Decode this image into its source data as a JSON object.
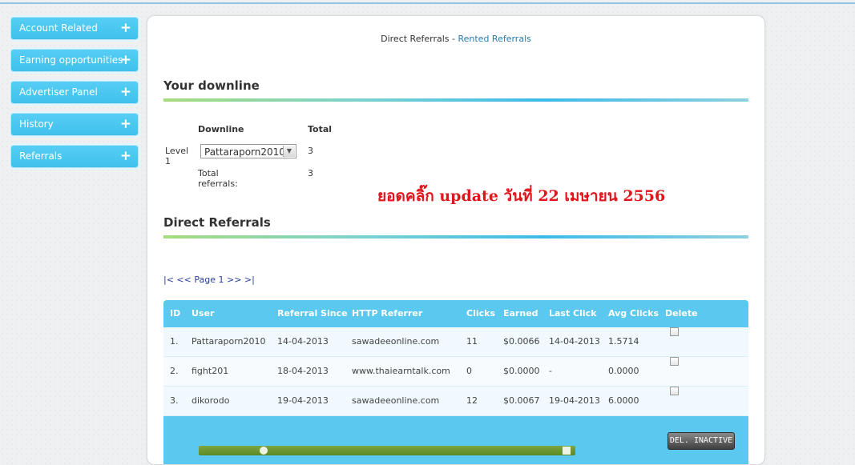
{
  "sidebar": {
    "items": [
      {
        "label": "Account Related",
        "icon": "plus-icon"
      },
      {
        "label": "Earning opportunities",
        "icon": "plus-icon"
      },
      {
        "label": "Advertiser Panel",
        "icon": "plus-icon"
      },
      {
        "label": "History",
        "icon": "plus-icon"
      },
      {
        "label": "Referrals",
        "icon": "plus-icon"
      }
    ],
    "plus_glyph": "+"
  },
  "tabs": {
    "direct": "Direct Referrals",
    "separator": " - ",
    "rented": "Rented Referrals"
  },
  "downline": {
    "title": "Your downline",
    "col_downline": "Downline",
    "col_total": "Total",
    "level_label": "Level 1",
    "selected_user": "Pattaraporn2010",
    "level_total": "3",
    "total_label": "Total referrals:",
    "total_value": "3"
  },
  "note": "ยอดคลิ๊ก update วันที่ 22 เมษายน 2556",
  "direct": {
    "title": "Direct Referrals",
    "pager": "|< << Page 1 >> >|",
    "headers": [
      "ID",
      "User",
      "Referral Since",
      "HTTP Referrer",
      "Clicks",
      "Earned",
      "Last Click",
      "Avg Clicks",
      "Delete"
    ],
    "rows": [
      {
        "id": "1.",
        "user": "Pattaraporn2010",
        "since": "14-04-2013",
        "referrer": "sawadeeonline.com",
        "clicks": "11",
        "earned": "$0.0066",
        "last": "14-04-2013",
        "avg": "1.5714",
        "delete": false
      },
      {
        "id": "2.",
        "user": "fight201",
        "since": "18-04-2013",
        "referrer": "www.thaiearntalk.com",
        "clicks": "0",
        "earned": "$0.0000",
        "last": "-",
        "avg": "0.0000",
        "delete": false
      },
      {
        "id": "3.",
        "user": "dikorodo",
        "since": "19-04-2013",
        "referrer": "sawadeeonline.com",
        "clicks": "12",
        "earned": "$0.0067",
        "last": "19-04-2013",
        "avg": "6.0000",
        "delete": false
      }
    ],
    "del_inactive": "DEL. INACTIVE"
  },
  "colors": {
    "accent": "#5ac8ef",
    "sidebar": "#3fc1ec",
    "note": "#e1161c",
    "link": "#2a7ab0"
  }
}
